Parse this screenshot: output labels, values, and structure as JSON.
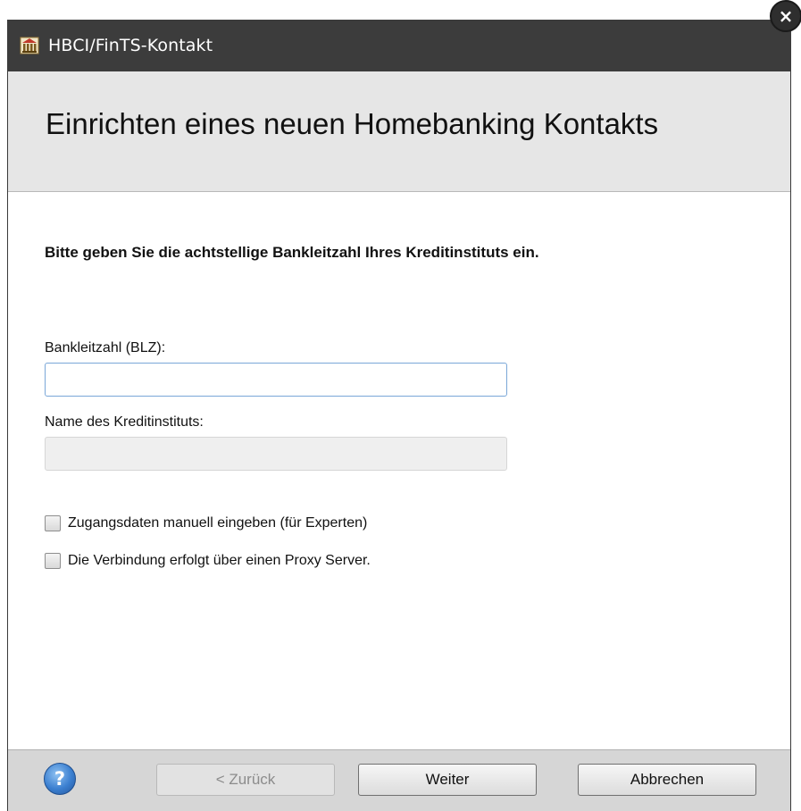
{
  "window": {
    "title": "HBCI/FinTS-Kontakt",
    "close_glyph": "×",
    "app_icon": "bank-icon"
  },
  "header": {
    "heading": "Einrichten eines neuen Homebanking Kontakts"
  },
  "form": {
    "instruction": "Bitte geben Sie die achtstellige Bankleitzahl Ihres Kreditinstituts ein.",
    "blz_label": "Bankleitzahl (BLZ):",
    "blz_value": "",
    "bank_name_label": "Name des Kreditinstituts:",
    "bank_name_value": "",
    "options": [
      {
        "label": "Zugangsdaten manuell eingeben (für Experten)",
        "checked": false
      },
      {
        "label": "Die Verbindung erfolgt über einen Proxy Server.",
        "checked": false
      }
    ]
  },
  "footer": {
    "help_glyph": "?",
    "back_label": "< Zurück",
    "next_label": "Weiter",
    "cancel_label": "Abbrechen"
  },
  "colors": {
    "titlebar": "#3c3c3c",
    "header_bg": "#e6e6e6",
    "footer_bg": "#d6d6d6",
    "focus_border": "#7aa7d8"
  }
}
